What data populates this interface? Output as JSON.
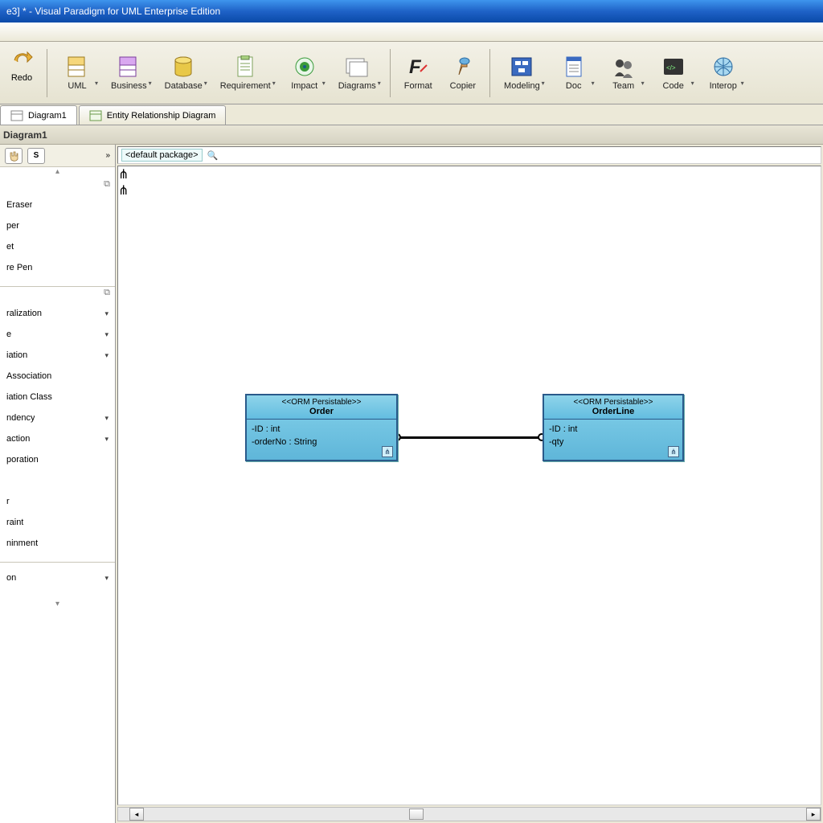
{
  "titlebar": {
    "text": "e3] * - Visual Paradigm for UML Enterprise Edition"
  },
  "toolbar": {
    "redo": "Redo",
    "items": [
      {
        "label": "UML"
      },
      {
        "label": "Business"
      },
      {
        "label": "Database"
      },
      {
        "label": "Requirement"
      },
      {
        "label": "Impact"
      },
      {
        "label": "Diagrams"
      }
    ],
    "group2": [
      {
        "label": "Format"
      },
      {
        "label": "Copier"
      }
    ],
    "group3": [
      {
        "label": "Modeling"
      },
      {
        "label": "Doc"
      },
      {
        "label": "Team"
      },
      {
        "label": "Code"
      },
      {
        "label": "Interop"
      }
    ]
  },
  "tabs": {
    "t1": "Diagram1",
    "t2": "Entity Relationship Diagram"
  },
  "diagram_title": "Diagram1",
  "sidepanel": {
    "chip": "S",
    "chev": "»",
    "group1": [
      "Eraser",
      "per",
      "et",
      "re Pen"
    ],
    "group2": [
      "ralization",
      "e",
      "iation",
      "Association",
      "iation Class",
      "ndency",
      "action",
      "poration",
      "",
      "r",
      "raint",
      "ninment"
    ],
    "group3": [
      "on"
    ]
  },
  "breadcrumb": {
    "package": "<default package>"
  },
  "class_order": {
    "stereo": "<<ORM Persistable>>",
    "name": "Order",
    "attr1": "-ID : int",
    "attr2": "-orderNo : String"
  },
  "class_orderline": {
    "stereo": "<<ORM Persistable>>",
    "name": "OrderLine",
    "attr1": "-ID : int",
    "attr2": "-qty"
  }
}
